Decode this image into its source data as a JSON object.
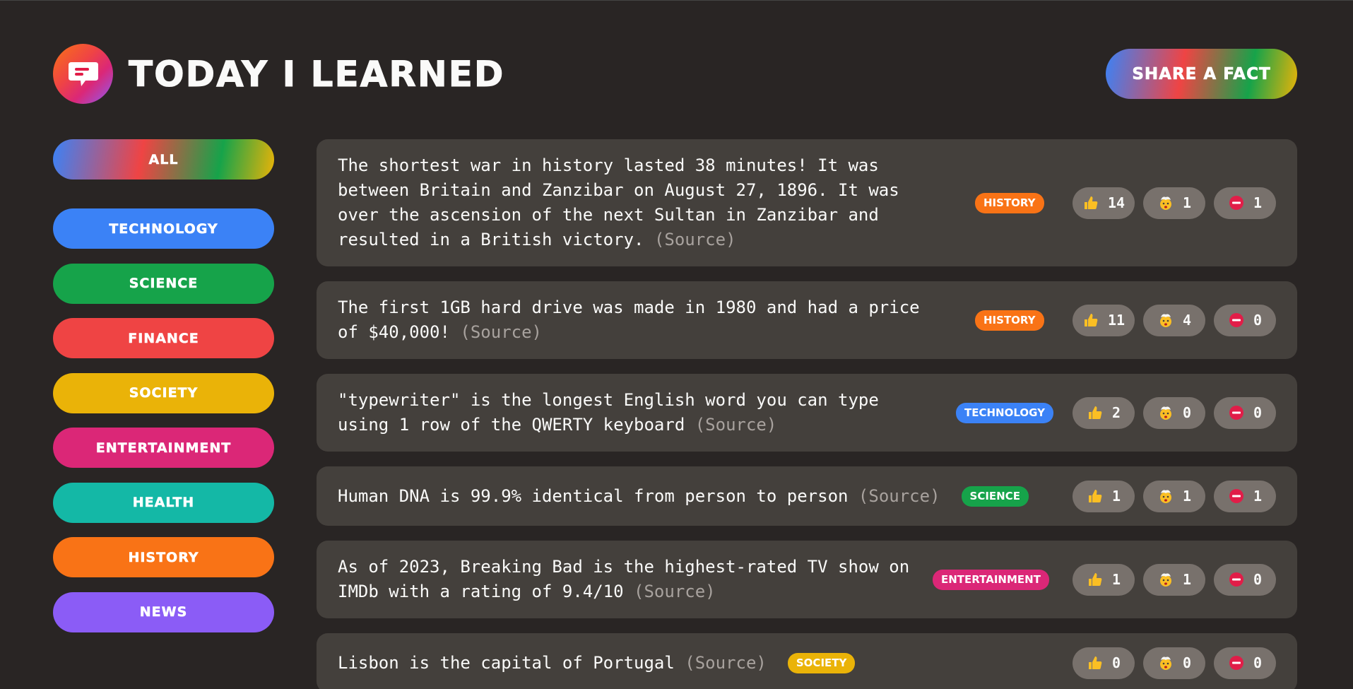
{
  "header": {
    "title": "Today I Learned",
    "share_label": "Share a fact"
  },
  "categories": [
    {
      "label": "All",
      "color": "gradient"
    },
    {
      "label": "technology",
      "color": "#3b82f6"
    },
    {
      "label": "science",
      "color": "#16a34a"
    },
    {
      "label": "finance",
      "color": "#ef4444"
    },
    {
      "label": "society",
      "color": "#eab308"
    },
    {
      "label": "entertainment",
      "color": "#db2777"
    },
    {
      "label": "health",
      "color": "#14b8a6"
    },
    {
      "label": "history",
      "color": "#f97316"
    },
    {
      "label": "news",
      "color": "#8b5cf6"
    }
  ],
  "facts": [
    {
      "text": "The shortest war in history lasted 38 minutes! It was between Britain and Zanzibar on August 27, 1896. It was over the ascension of the next Sultan in Zanzibar and resulted in a British victory.",
      "source_label": "(Source)",
      "category": "history",
      "category_color": "#f97316",
      "interesting": "14",
      "mindblowing": "1",
      "false": "1"
    },
    {
      "text": "The first 1GB hard drive was made in 1980 and had a price of $40,000!",
      "source_label": "(Source)",
      "category": "history",
      "category_color": "#f97316",
      "interesting": "11",
      "mindblowing": "4",
      "false": "0"
    },
    {
      "text": "\"typewriter\" is the longest English word you can type using 1 row of the QWERTY keyboard",
      "source_label": "(Source)",
      "category": "technology",
      "category_color": "#3b82f6",
      "interesting": "2",
      "mindblowing": "0",
      "false": "0"
    },
    {
      "text": "Human DNA is 99.9% identical from person to person",
      "source_label": "(Source)",
      "category": "science",
      "category_color": "#16a34a",
      "interesting": "1",
      "mindblowing": "1",
      "false": "1"
    },
    {
      "text": "As of 2023, Breaking Bad is the highest-rated TV show on IMDb with a rating of 9.4/10",
      "source_label": "(Source)",
      "category": "entertainment",
      "category_color": "#db2777",
      "interesting": "1",
      "mindblowing": "1",
      "false": "0"
    },
    {
      "text": "Lisbon is the capital of Portugal",
      "source_label": "(Source)",
      "category": "society",
      "category_color": "#eab308",
      "interesting": "0",
      "mindblowing": "0",
      "false": "0"
    }
  ],
  "icons": {
    "logo": "speech-bubble-icon",
    "interesting": "thumbs-up-icon",
    "mindblowing": "mind-blown-icon",
    "false": "no-entry-icon"
  }
}
